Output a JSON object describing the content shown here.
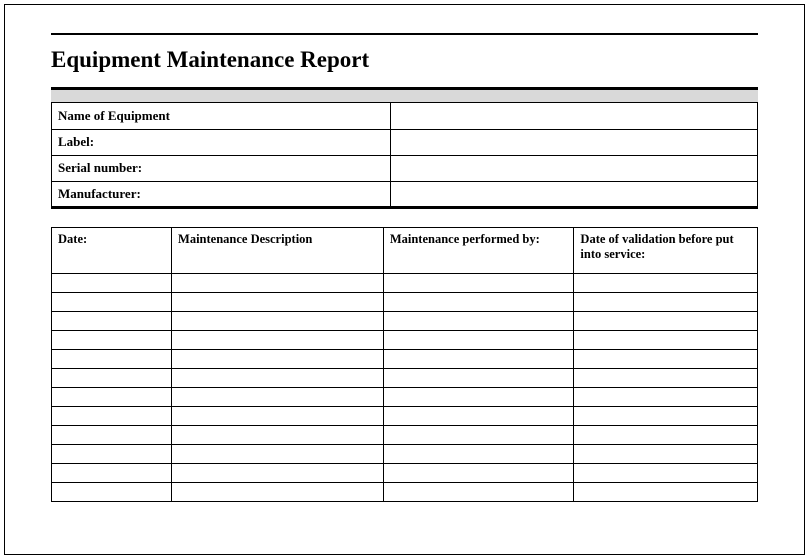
{
  "title": "Equipment Maintenance Report",
  "info": {
    "name_label": "Name of Equipment",
    "name_value": "",
    "label_label": "Label:",
    "label_value": "",
    "serial_label": "Serial number:",
    "serial_value": "",
    "manufacturer_label": "Manufacturer:",
    "manufacturer_value": ""
  },
  "log": {
    "headers": {
      "date": "Date:",
      "description": "Maintenance Description",
      "performed_by": "Maintenance performed by:",
      "validation": "Date of validation before put into service:"
    },
    "rows": [
      {
        "date": "",
        "description": "",
        "performed_by": "",
        "validation": ""
      },
      {
        "date": "",
        "description": "",
        "performed_by": "",
        "validation": ""
      },
      {
        "date": "",
        "description": "",
        "performed_by": "",
        "validation": ""
      },
      {
        "date": "",
        "description": "",
        "performed_by": "",
        "validation": ""
      },
      {
        "date": "",
        "description": "",
        "performed_by": "",
        "validation": ""
      },
      {
        "date": "",
        "description": "",
        "performed_by": "",
        "validation": ""
      },
      {
        "date": "",
        "description": "",
        "performed_by": "",
        "validation": ""
      },
      {
        "date": "",
        "description": "",
        "performed_by": "",
        "validation": ""
      },
      {
        "date": "",
        "description": "",
        "performed_by": "",
        "validation": ""
      },
      {
        "date": "",
        "description": "",
        "performed_by": "",
        "validation": ""
      },
      {
        "date": "",
        "description": "",
        "performed_by": "",
        "validation": ""
      },
      {
        "date": "",
        "description": "",
        "performed_by": "",
        "validation": ""
      }
    ]
  }
}
